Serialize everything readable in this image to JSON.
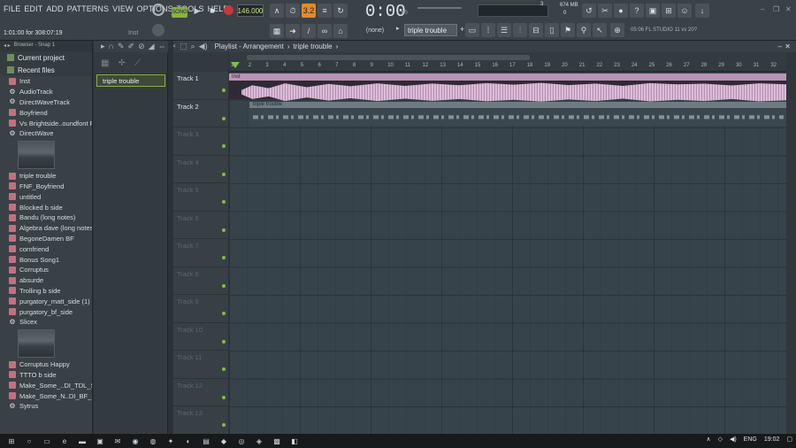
{
  "menu": [
    "FILE",
    "EDIT",
    "ADD",
    "PATTERNS",
    "VIEW",
    "OPTIONS",
    "TOOLS",
    "HELP"
  ],
  "hint": "1:01:00 for 308:07:19",
  "hint_right": "Inst",
  "transport": {
    "mode": "SONG",
    "tempo": "146.000",
    "time": "0:00",
    "time_sub": "00",
    "cpu_top": "674 MB",
    "cpu_num1": "3",
    "cpu_num2": "0"
  },
  "pattern_selector": {
    "none": "(none)",
    "current": "triple trouble"
  },
  "snap_info": "05:06 FL STUDIO 11 vs 20?",
  "browser": {
    "header": "Browser - Snap 1",
    "current_project": "Current project",
    "recent_files": "Recent files",
    "items_a": [
      "Inst",
      "AudioTrack",
      "DirectWaveTrack",
      "Boyfriend",
      "Vs Brightside..oundfont Pack",
      "DirectWave"
    ],
    "items_b": [
      "triple trouble",
      "FNF_Boyfriend",
      "untitled",
      "Blocked b side",
      "Bandu (long notes)",
      "Algebra dave (long notes)",
      "BegoneDamen BF",
      "cornfriend",
      "Bonus Song1",
      "Corruptus",
      "absurde",
      "Trolling b side",
      "purgatory_matt_side (1)",
      "purgatory_bf_side",
      "Slicex"
    ],
    "items_c": [
      "Corruptus Happy",
      "TTTO b side",
      "Make_Some_..DI_TDL_Side",
      "Make_Some_N..DI_BF_Side",
      "Sytrus"
    ]
  },
  "pattern_item": "triple trouble",
  "playlist": {
    "title": "Playlist - Arrangement",
    "sep": "›",
    "pattern": "triple trouble"
  },
  "tracks": [
    "Track 1",
    "Track 2",
    "Track 3",
    "Track 4",
    "Track 5",
    "Track 6",
    "Track 7",
    "Track 8",
    "Track 9",
    "Track 10",
    "Track 11",
    "Track 12",
    "Track 13"
  ],
  "ruler": [
    "1",
    "2",
    "3",
    "4",
    "5",
    "6",
    "7",
    "8",
    "9",
    "10",
    "11",
    "12",
    "13",
    "14",
    "15",
    "16",
    "17",
    "18",
    "19",
    "20",
    "21",
    "22",
    "23",
    "24",
    "25",
    "26",
    "27",
    "28",
    "29",
    "30",
    "31",
    "32"
  ],
  "clips": {
    "clip1": "Inst",
    "clip2": "triple trouble"
  },
  "taskbar": {
    "lang": "ENG",
    "clock": "19:02"
  }
}
